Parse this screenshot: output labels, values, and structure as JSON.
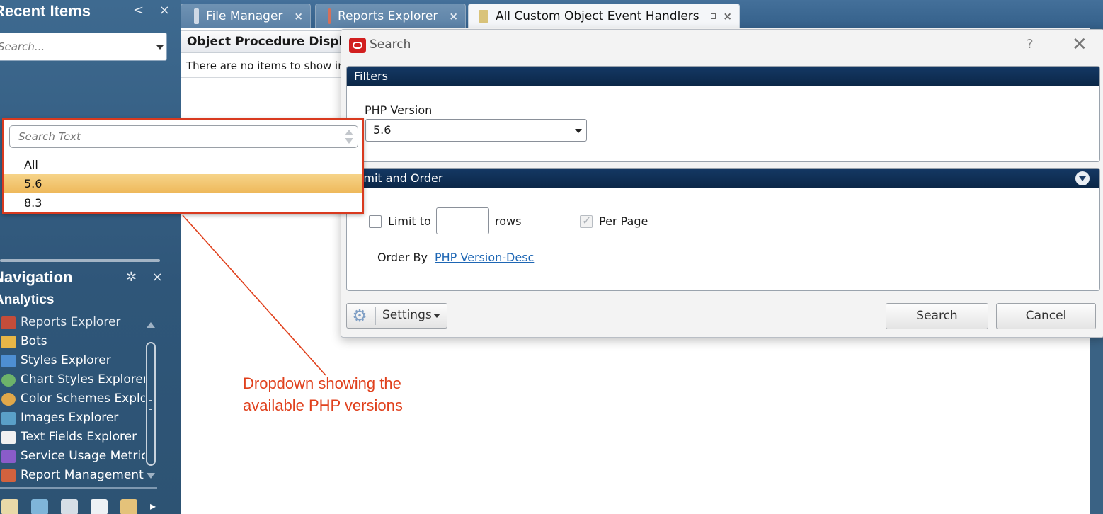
{
  "recent_items": {
    "title": "Recent Items",
    "controls": "< ×",
    "search_placeholder": "Search..."
  },
  "navigation": {
    "title": "Navigation",
    "controls": "✲ ×",
    "group": "Analytics",
    "items": [
      {
        "label": "Reports Explorer",
        "icon": "reports-icon"
      },
      {
        "label": "Bots",
        "icon": "folder-icon"
      },
      {
        "label": "Styles Explorer",
        "icon": "styles-icon"
      },
      {
        "label": "Chart Styles Explorer",
        "icon": "chart-styles-icon"
      },
      {
        "label": "Color Schemes Explorer",
        "icon": "color-schemes-icon"
      },
      {
        "label": "Images Explorer",
        "icon": "images-icon"
      },
      {
        "label": "Text Fields Explorer",
        "icon": "text-fields-icon"
      },
      {
        "label": "Service Usage Metrics",
        "icon": "metrics-icon"
      },
      {
        "label": "Report Management",
        "icon": "report-management-icon"
      }
    ],
    "bottom_icons": [
      "home-icon",
      "quick-icon",
      "headset-icon",
      "contacts-icon",
      "tasks-icon",
      "more-icon"
    ]
  },
  "tabs": [
    {
      "label": "File Manager",
      "close": "×"
    },
    {
      "label": "Reports Explorer",
      "close": "×"
    },
    {
      "label": "All Custom Object Event Handlers",
      "close": "×"
    }
  ],
  "grid": {
    "header": "Object Procedure Display",
    "empty": "There are no items to show in this view."
  },
  "dialog": {
    "title": "Search",
    "help": "?",
    "close": "✕",
    "filters": {
      "title": "Filters",
      "php_label": "PHP Version",
      "php_value": "5.6"
    },
    "limit": {
      "title": "Limit and Order",
      "limit_to": "Limit to",
      "rows": "rows",
      "per_page": "Per Page",
      "order_by": "Order By",
      "order_link": "PHP Version-Desc"
    },
    "settings_label": "Settings",
    "search_btn": "Search",
    "cancel_btn": "Cancel"
  },
  "dropdown": {
    "search_placeholder": "Search Text",
    "options": [
      "All",
      "5.6",
      "8.3"
    ],
    "selected": "5.6"
  },
  "annotation": {
    "line1": "Dropdown showing the",
    "line2": "available PHP versions",
    "color": "#e0401c"
  }
}
